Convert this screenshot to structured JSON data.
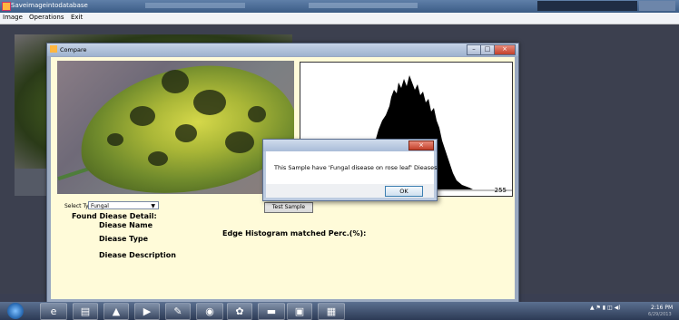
{
  "app": {
    "title": "Saveimageintodatabase",
    "menu": [
      "Image",
      "Operations",
      "Exit"
    ]
  },
  "compare_window": {
    "title": "Compare",
    "minimize": "–",
    "maximize": "□",
    "close": "×"
  },
  "histogram": {
    "max_label": "255"
  },
  "form": {
    "select_type_label": "Select Type",
    "selected_type": "Fungal",
    "test_button": "Test Sample",
    "found_detail": "Found Diease Detail:",
    "disease_name": "Diease Name",
    "disease_type": "Diease Type",
    "disease_description": "Diease Description",
    "edge_histogram": "Edge Histogram matched Perc.(%):"
  },
  "message_box": {
    "text": "This Sample have 'Fungal disease on rose leaf' Dieases",
    "ok_button": "OK",
    "close": "×"
  },
  "taskbar": {
    "time": "2:16 PM",
    "date": "6/29/2013",
    "apps": [
      "ie-icon",
      "folder-icon",
      "vlc-icon",
      "media-player-icon",
      "paint-icon",
      "chrome-icon",
      "picasa-icon",
      "app-icon",
      "powerpoint-icon",
      "visual-studio-icon"
    ]
  },
  "colors": {
    "form_background": "#fffbd9",
    "titlebar": "#3b5c86",
    "taskbar": "#2c3a55"
  }
}
